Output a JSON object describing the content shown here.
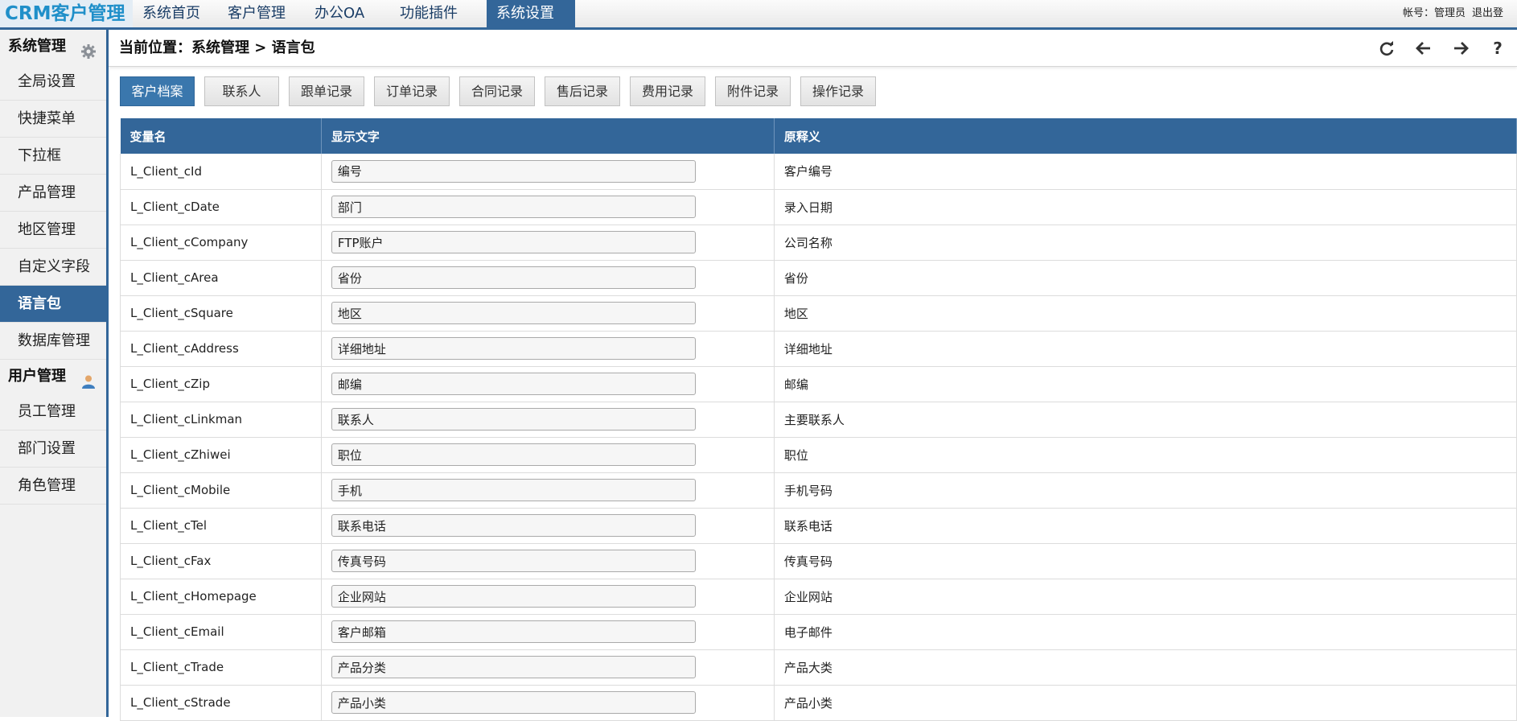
{
  "app": {
    "logo": "CRM客户管理"
  },
  "nav": {
    "items": [
      "系统首页",
      "客户管理",
      "办公OA",
      "功能插件",
      "系统设置"
    ],
    "active_index": 4
  },
  "account": {
    "label": "帐号：管理员",
    "logout": "退出登"
  },
  "sidebar": {
    "group1": {
      "title": "系统管理",
      "icon": "gear-icon"
    },
    "items1": [
      "全局设置",
      "快捷菜单",
      "下拉框",
      "产品管理",
      "地区管理",
      "自定义字段",
      "语言包",
      "数据库管理"
    ],
    "active_item": "语言包",
    "group2": {
      "title": "用户管理",
      "icon": "user-icon"
    },
    "items2": [
      "员工管理",
      "部门设置",
      "角色管理"
    ]
  },
  "breadcrumb": "当前位置：系统管理 > 语言包",
  "toolbar": {
    "icons": [
      "refresh-icon",
      "back-arrow-icon",
      "forward-arrow-icon",
      "help-icon"
    ],
    "help_glyph": "?"
  },
  "tabs": [
    "客户档案",
    "联系人",
    "跟单记录",
    "订单记录",
    "合同记录",
    "售后记录",
    "费用记录",
    "附件记录",
    "操作记录"
  ],
  "table": {
    "headers": [
      "变量名",
      "显示文字",
      "原释义"
    ],
    "rows": [
      {
        "var": "L_Client_cId",
        "display": "编号",
        "orig": "客户编号"
      },
      {
        "var": "L_Client_cDate",
        "display": "部门",
        "orig": "录入日期"
      },
      {
        "var": "L_Client_cCompany",
        "display": "FTP账户",
        "orig": "公司名称"
      },
      {
        "var": "L_Client_cArea",
        "display": "省份",
        "orig": "省份"
      },
      {
        "var": "L_Client_cSquare",
        "display": "地区",
        "orig": "地区"
      },
      {
        "var": "L_Client_cAddress",
        "display": "详细地址",
        "orig": "详细地址"
      },
      {
        "var": "L_Client_cZip",
        "display": "邮编",
        "orig": "邮编"
      },
      {
        "var": "L_Client_cLinkman",
        "display": "联系人",
        "orig": "主要联系人"
      },
      {
        "var": "L_Client_cZhiwei",
        "display": "职位",
        "orig": "职位"
      },
      {
        "var": "L_Client_cMobile",
        "display": "手机",
        "orig": "手机号码"
      },
      {
        "var": "L_Client_cTel",
        "display": "联系电话",
        "orig": "联系电话"
      },
      {
        "var": "L_Client_cFax",
        "display": "传真号码",
        "orig": "传真号码"
      },
      {
        "var": "L_Client_cHomepage",
        "display": "企业网站",
        "orig": "企业网站"
      },
      {
        "var": "L_Client_cEmail",
        "display": "客户邮箱",
        "orig": "电子邮件"
      },
      {
        "var": "L_Client_cTrade",
        "display": "产品分类",
        "orig": "产品大类"
      },
      {
        "var": "L_Client_cStrade",
        "display": "产品小类",
        "orig": "产品小类"
      }
    ]
  },
  "colors": {
    "accent": "#336699",
    "logo": "#1f8fc9"
  }
}
